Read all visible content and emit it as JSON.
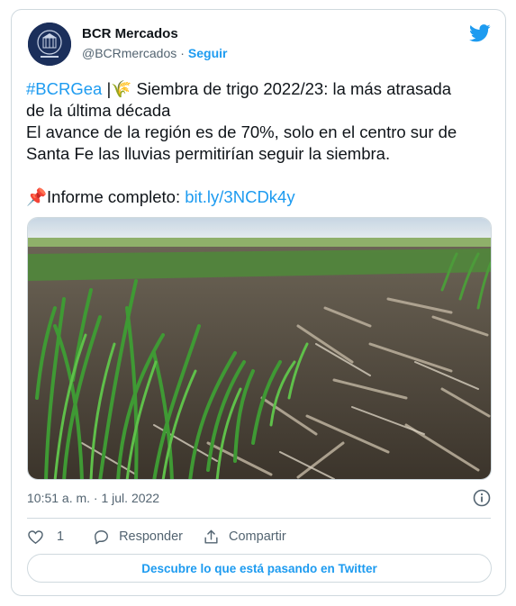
{
  "author": {
    "name": "BCR Mercados",
    "handle": "@BCRmercados",
    "separator": "·",
    "follow_label": "Seguir"
  },
  "tweet": {
    "hashtag": "#BCRGea",
    "title_rest": " |🌾 Siembra de trigo 2022/23: la más atrasada",
    "line2": "de la última década",
    "line3": "El avance de la región es de 70%, solo en el centro sur de",
    "line4": "Santa Fe las lluvias permitirían seguir la siembra.",
    "report_prefix": "📌Informe completo: ",
    "report_link": "bit.ly/3NCDk4y"
  },
  "meta": {
    "timestamp": "10:51 a. m. · 1 jul. 2022"
  },
  "actions": {
    "like_count": "1",
    "reply_label": "Responder",
    "share_label": "Compartir"
  },
  "footer": {
    "discover_label": "Descubre lo que está pasando en Twitter"
  },
  "colors": {
    "accent": "#1d9bf0",
    "text": "#0f1419",
    "muted": "#536471",
    "border": "#cfd9de"
  }
}
